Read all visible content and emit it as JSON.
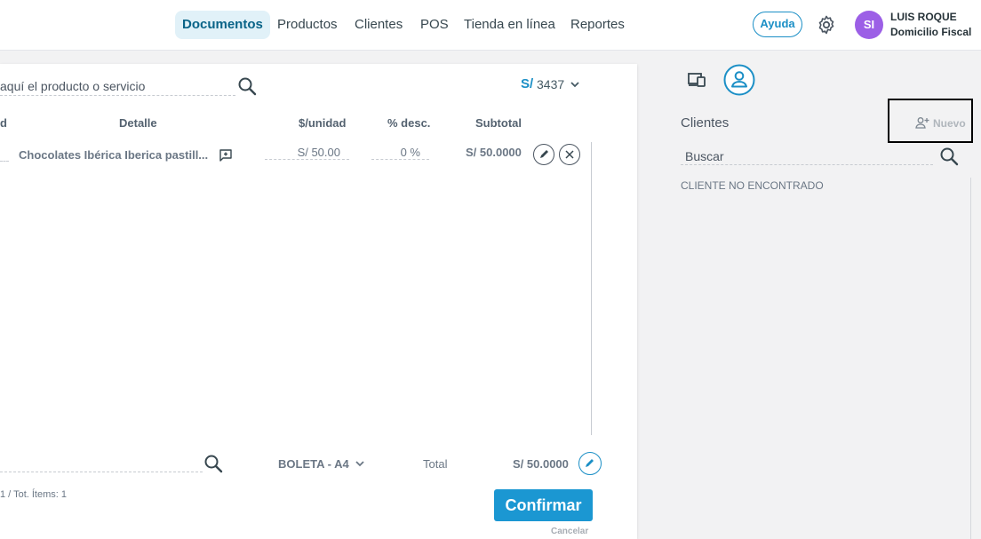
{
  "nav": {
    "items": [
      "Documentos",
      "Productos",
      "Clientes",
      "POS",
      "Tienda en línea",
      "Reportes"
    ],
    "help": "Ayuda"
  },
  "user": {
    "initials": "SI",
    "name": "LUIS ROQUE",
    "place": "Domicilio Fiscal"
  },
  "product_search": {
    "placeholder": "aquí el producto o servicio"
  },
  "currency": {
    "symbol": "S/",
    "value": "3437"
  },
  "table": {
    "headers": [
      "d",
      "Detalle",
      "$/unidad",
      "% desc.",
      "Subtotal"
    ],
    "rows": [
      {
        "detail": "Chocolates Ibérica Iberica pastill...",
        "unit_price": "S/ 50.00",
        "discount": "0 %",
        "subtotal": "S/ 50.0000"
      }
    ]
  },
  "footer": {
    "doc_type": "BOLETA - A4",
    "total_label": "Total",
    "total_value": "S/ 50.0000",
    "items_count": "1 / Tot. Ítems: 1",
    "confirm": "Confirmar",
    "cancel": "Cancelar"
  },
  "clients_panel": {
    "title": "Clientes",
    "new_label": "Nuevo",
    "search_placeholder": "Buscar",
    "empty_message": "CLIENTE NO ENCONTRADO"
  },
  "colors": {
    "accent": "#1b97d2",
    "avatar": "#9c5fe6",
    "active_nav_bg": "#e1f1f8"
  }
}
